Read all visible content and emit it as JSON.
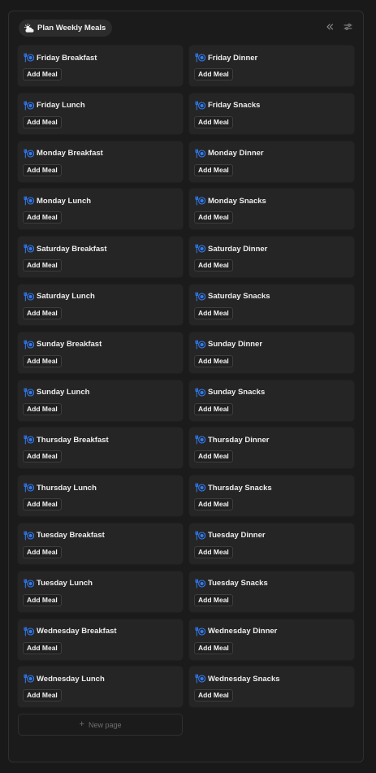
{
  "view": {
    "title": "Plan Weekly Meals",
    "icon": "sun-cloud-icon"
  },
  "toolbar": {
    "collapse_icon": "double-chevron-left-icon",
    "settings_icon": "sliders-icon"
  },
  "cards": [
    {
      "title": "Friday Breakfast",
      "button": "Add Meal"
    },
    {
      "title": "Friday Dinner",
      "button": "Add Meal"
    },
    {
      "title": "Friday Lunch",
      "button": "Add Meal"
    },
    {
      "title": "Friday Snacks",
      "button": "Add Meal"
    },
    {
      "title": "Monday Breakfast",
      "button": "Add Meal"
    },
    {
      "title": "Monday Dinner",
      "button": "Add Meal"
    },
    {
      "title": "Monday Lunch",
      "button": "Add Meal"
    },
    {
      "title": "Monday Snacks",
      "button": "Add Meal"
    },
    {
      "title": "Saturday Breakfast",
      "button": "Add Meal"
    },
    {
      "title": "Saturday Dinner",
      "button": "Add Meal"
    },
    {
      "title": "Saturday Lunch",
      "button": "Add Meal"
    },
    {
      "title": "Saturday Snacks",
      "button": "Add Meal"
    },
    {
      "title": "Sunday Breakfast",
      "button": "Add Meal"
    },
    {
      "title": "Sunday Dinner",
      "button": "Add Meal"
    },
    {
      "title": "Sunday Lunch",
      "button": "Add Meal"
    },
    {
      "title": "Sunday Snacks",
      "button": "Add Meal"
    },
    {
      "title": "Thursday Breakfast",
      "button": "Add Meal"
    },
    {
      "title": "Thursday Dinner",
      "button": "Add Meal"
    },
    {
      "title": "Thursday Lunch",
      "button": "Add Meal"
    },
    {
      "title": "Thursday Snacks",
      "button": "Add Meal"
    },
    {
      "title": "Tuesday Breakfast",
      "button": "Add Meal"
    },
    {
      "title": "Tuesday Dinner",
      "button": "Add Meal"
    },
    {
      "title": "Tuesday Lunch",
      "button": "Add Meal"
    },
    {
      "title": "Tuesday Snacks",
      "button": "Add Meal"
    },
    {
      "title": "Wednesday Breakfast",
      "button": "Add Meal"
    },
    {
      "title": "Wednesday Dinner",
      "button": "Add Meal"
    },
    {
      "title": "Wednesday Lunch",
      "button": "Add Meal"
    },
    {
      "title": "Wednesday Snacks",
      "button": "Add Meal"
    }
  ],
  "card_icon": "fork-plate-icon",
  "new_page": {
    "label": "New page",
    "icon": "plus-icon"
  },
  "colors": {
    "background": "#191919",
    "card": "#252525",
    "accent_icon": "#2f7bf5",
    "muted_text": "#6f6f6f"
  }
}
